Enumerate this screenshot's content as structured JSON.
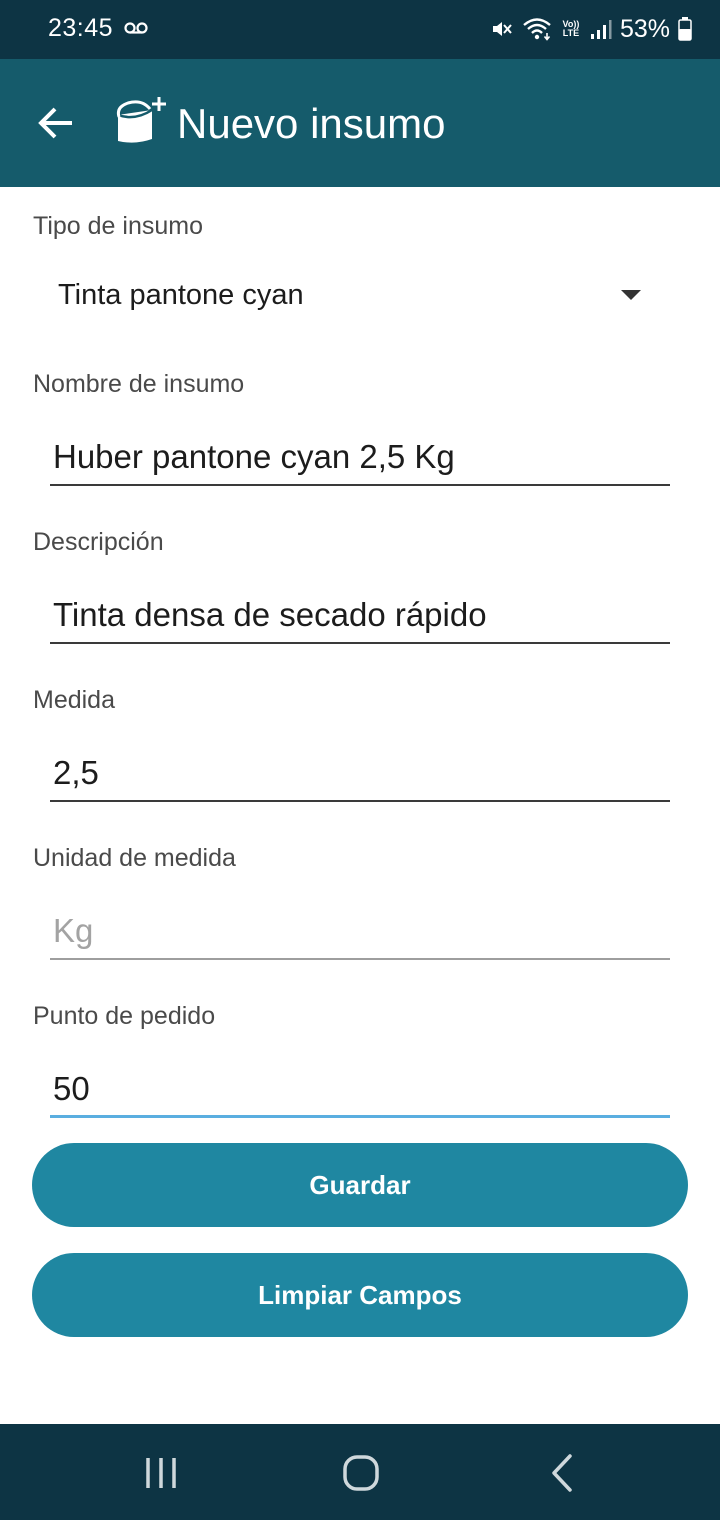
{
  "status_bar": {
    "time": "23:45",
    "battery_percent": "53%",
    "network_label": "Vo)) LTE",
    "icons": [
      "voicemail-icon",
      "mute-icon",
      "wifi-icon",
      "signal-icon",
      "battery-icon"
    ]
  },
  "app_bar": {
    "title": "Nuevo insumo",
    "back_icon": "arrow-left-icon",
    "title_icon": "paint-bucket-add-icon"
  },
  "form": {
    "tipo": {
      "label": "Tipo de insumo",
      "value": "Tinta pantone cyan"
    },
    "nombre": {
      "label": "Nombre de insumo",
      "value": "Huber pantone cyan 2,5 Kg"
    },
    "descripcion": {
      "label": "Descripción",
      "value": "Tinta densa de secado rápido"
    },
    "medida": {
      "label": "Medida",
      "value": "2,5"
    },
    "unidad": {
      "label": "Unidad de medida",
      "value": "Kg"
    },
    "punto": {
      "label": "Punto de pedido",
      "value": "50"
    }
  },
  "buttons": {
    "guardar": "Guardar",
    "limpiar": "Limpiar Campos"
  },
  "colors": {
    "status_bar": "#0d3444",
    "app_bar": "#155b6b",
    "button": "#1f87a1",
    "focus_underline": "#5aaee0"
  }
}
